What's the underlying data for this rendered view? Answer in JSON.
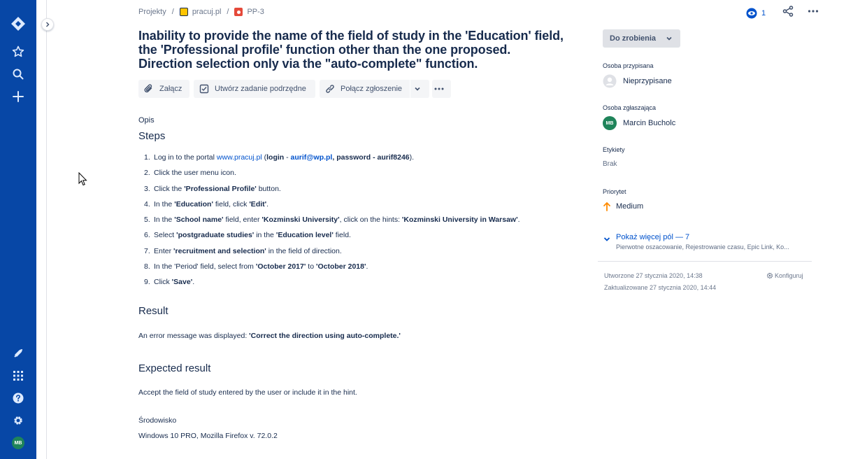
{
  "nav": {
    "user_initials": "MB"
  },
  "breadcrumbs": {
    "root": "Projekty",
    "project": "pracuj.pl",
    "issue_key": "PP-3"
  },
  "topright": {
    "watchers_count": "1"
  },
  "issue": {
    "title_lines": [
      "Inability to provide the name of the field of study in the 'Education' field,",
      "the 'Professional profile' function other than the one proposed.",
      "Direction selection only via the \"auto-complete\" function."
    ]
  },
  "toolbar": {
    "attach_label": "Załącz",
    "subtask_label": "Utwórz zadanie podrzędne",
    "link_label": "Połącz zgłoszenie"
  },
  "description": {
    "label": "Opis",
    "steps_heading": "Steps",
    "steps": [
      {
        "num": "1.",
        "parts": [
          [
            "t",
            "Log in to the portal "
          ],
          [
            "l",
            "www.pracuj.pl"
          ],
          [
            "t",
            " ("
          ],
          [
            "b",
            "login"
          ],
          [
            "t",
            " - "
          ],
          [
            "lb",
            "aurif@wp.pl"
          ],
          [
            "b",
            ", password - aurif8246"
          ],
          [
            "t",
            ")."
          ]
        ]
      },
      {
        "num": "2.",
        "parts": [
          [
            "t",
            "Click the user menu icon."
          ]
        ]
      },
      {
        "num": "3.",
        "parts": [
          [
            "t",
            "Click the "
          ],
          [
            "b",
            "'Professional Profile'"
          ],
          [
            "t",
            " button."
          ]
        ]
      },
      {
        "num": "4.",
        "parts": [
          [
            "t",
            "In the "
          ],
          [
            "b",
            "'Education'"
          ],
          [
            "t",
            " field, click "
          ],
          [
            "b",
            "'Edit'"
          ],
          [
            "t",
            "."
          ]
        ]
      },
      {
        "num": "5.",
        "parts": [
          [
            "t",
            "In the "
          ],
          [
            "b",
            "'School name'"
          ],
          [
            "t",
            " field, enter "
          ],
          [
            "b",
            "'Kozminski University'"
          ],
          [
            "t",
            ", click on the hints: "
          ],
          [
            "b",
            "'Kozminski University in Warsaw'"
          ],
          [
            "t",
            "."
          ]
        ]
      },
      {
        "num": "6.",
        "parts": [
          [
            "t",
            "Select "
          ],
          [
            "b",
            "'postgraduate studies'"
          ],
          [
            "t",
            " in the "
          ],
          [
            "b",
            "'Education level'"
          ],
          [
            "t",
            " field."
          ]
        ]
      },
      {
        "num": "7.",
        "parts": [
          [
            "t",
            "Enter "
          ],
          [
            "b",
            "'recruitment and selection'"
          ],
          [
            "t",
            " in the field of direction."
          ]
        ]
      },
      {
        "num": "8.",
        "parts": [
          [
            "t",
            "In the 'Period' field, select from "
          ],
          [
            "b",
            "'October 2017'"
          ],
          [
            "t",
            " to "
          ],
          [
            "b",
            "'October 2018'"
          ],
          [
            "t",
            "."
          ]
        ]
      },
      {
        "num": "9.",
        "parts": [
          [
            "t",
            "Click "
          ],
          [
            "b",
            "'Save'"
          ],
          [
            "t",
            "."
          ]
        ]
      }
    ],
    "result_heading": "Result",
    "result_prefix": "An error message was displayed: ",
    "result_bold": "'Correct the direction using auto-complete.'",
    "expected_heading": "Expected result",
    "expected_text": "Accept the field of study entered by the user or include it in the hint.",
    "env_label": "Środowisko",
    "env_value": "Windows 10 PRO, Mozilla Firefox v. 72.0.2"
  },
  "sidebar": {
    "status": "Do zrobienia",
    "assignee_label": "Osoba przypisana",
    "assignee_value": "Nieprzypisane",
    "reporter_label": "Osoba zgłaszająca",
    "reporter_initials": "MB",
    "reporter_value": "Marcin Bucholc",
    "labels_label": "Etykiety",
    "labels_value": "Brak",
    "priority_label": "Priorytet",
    "priority_value": "Medium",
    "more_fields": "Pokaż więcej pól — 7",
    "more_fields_sub": "Pierwotne oszacowanie, Rejestrowanie czasu, Epic Link, Ko...",
    "created": "Utworzone 27 stycznia 2020, 14:38",
    "updated": "Zaktualizowane 27 stycznia 2020, 14:44",
    "configure": "Konfiguruj"
  },
  "colors": {
    "nav_bg": "#0747a6",
    "link": "#0052cc",
    "priority_medium": "#ff8b00",
    "reporter_avatar": "#1f845a"
  }
}
